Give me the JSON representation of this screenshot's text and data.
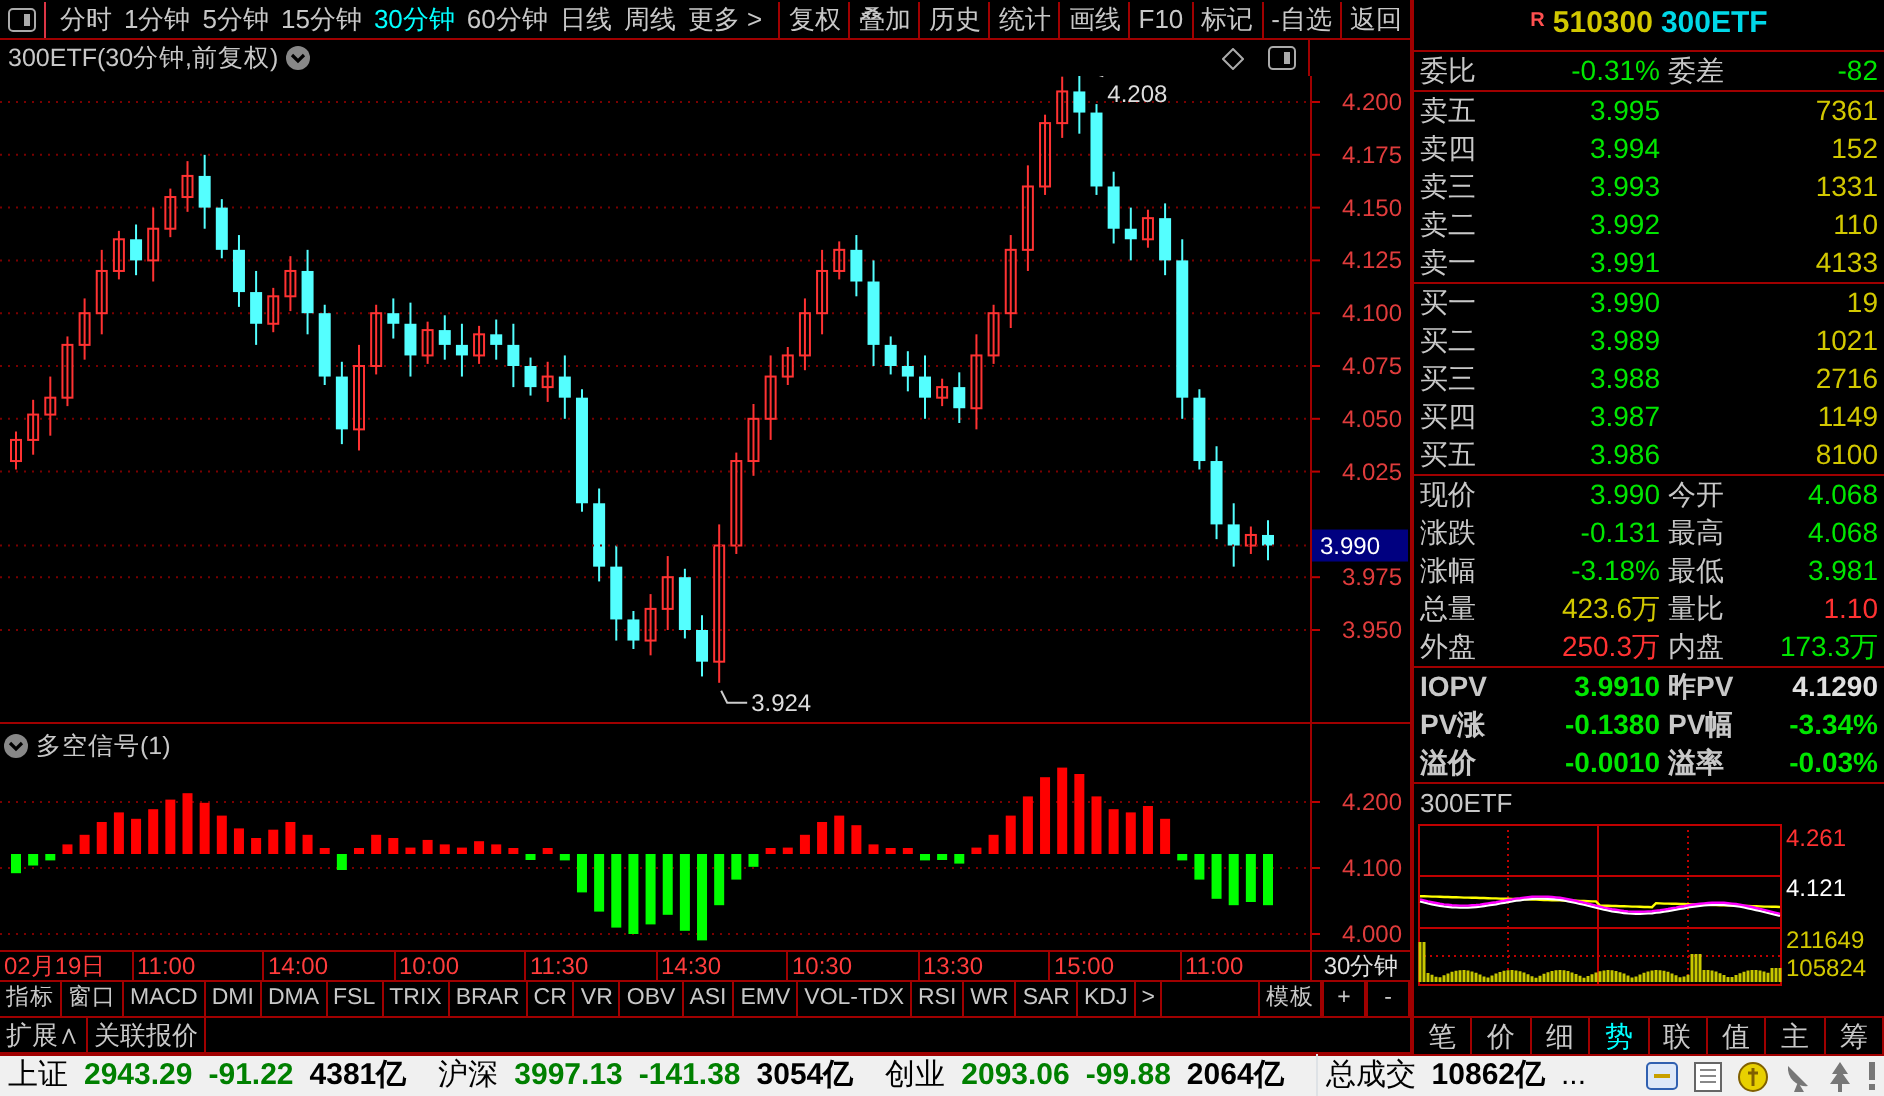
{
  "toolbar": {
    "periods": [
      {
        "label": "分时",
        "selected": false
      },
      {
        "label": "1分钟",
        "selected": false
      },
      {
        "label": "5分钟",
        "selected": false
      },
      {
        "label": "15分钟",
        "selected": false
      },
      {
        "label": "30分钟",
        "selected": true
      },
      {
        "label": "60分钟",
        "selected": false
      },
      {
        "label": "日线",
        "selected": false
      },
      {
        "label": "周线",
        "selected": false
      },
      {
        "label": "更多 >",
        "selected": false
      }
    ],
    "buttons": [
      "复权",
      "叠加",
      "历史",
      "统计",
      "画线",
      "F10",
      "标记",
      "-自选",
      "返回"
    ]
  },
  "chart": {
    "title": "300ETF(30分钟,前复权)",
    "high_label": "4.208",
    "low_label": "3.924",
    "price_ticks": [
      "4.200",
      "4.175",
      "4.150",
      "4.125",
      "4.100",
      "4.075",
      "4.050",
      "4.025",
      "3.975",
      "3.950"
    ],
    "current_price": "3.990"
  },
  "indicator": {
    "title": "多空信号(1)",
    "ticks": [
      "4.200",
      "4.100",
      "4.000"
    ]
  },
  "time_axis": {
    "date": "02月19日",
    "times": [
      "11:00",
      "14:00",
      "10:00",
      "11:30",
      "14:30",
      "10:30",
      "13:30",
      "15:00",
      "11:00"
    ],
    "period": "30分钟"
  },
  "indicator_tabs": {
    "items": [
      "指标",
      "窗口",
      "MACD",
      "DMI",
      "DMA",
      "FSL",
      "TRIX",
      "BRAR",
      "CR",
      "VR",
      "OBV",
      "ASI",
      "EMV",
      "VOL-TDX",
      "RSI",
      "WR",
      "SAR",
      "KDJ",
      ">"
    ],
    "right": [
      "模板",
      "+",
      "-"
    ]
  },
  "extra_tabs": [
    "扩展∧",
    "关联报价"
  ],
  "quote": {
    "flag": "R",
    "code": "510300",
    "name": "300ETF",
    "summary": [
      {
        "label": "委比",
        "value": "-0.31%"
      },
      {
        "label": "委差",
        "value": "-82"
      }
    ],
    "asks": [
      {
        "label": "卖五",
        "price": "3.995",
        "volume": "7361"
      },
      {
        "label": "卖四",
        "price": "3.994",
        "volume": "152"
      },
      {
        "label": "卖三",
        "price": "3.993",
        "volume": "1331"
      },
      {
        "label": "卖二",
        "price": "3.992",
        "volume": "110"
      },
      {
        "label": "卖一",
        "price": "3.991",
        "volume": "4133"
      }
    ],
    "bids": [
      {
        "label": "买一",
        "price": "3.990",
        "volume": "19"
      },
      {
        "label": "买二",
        "price": "3.989",
        "volume": "1021"
      },
      {
        "label": "买三",
        "price": "3.988",
        "volume": "2716"
      },
      {
        "label": "买四",
        "price": "3.987",
        "volume": "1149"
      },
      {
        "label": "买五",
        "price": "3.986",
        "volume": "8100"
      }
    ],
    "stats": [
      {
        "label": "现价",
        "value": "3.990",
        "color": "#00e600"
      },
      {
        "label": "今开",
        "value": "4.068",
        "color": "#00e600"
      },
      {
        "label": "涨跌",
        "value": "-0.131",
        "color": "#00e600"
      },
      {
        "label": "最高",
        "value": "4.068",
        "color": "#00e600"
      },
      {
        "label": "涨幅",
        "value": "-3.18%",
        "color": "#00e600"
      },
      {
        "label": "最低",
        "value": "3.981",
        "color": "#00e600"
      },
      {
        "label": "总量",
        "value": "423.6万",
        "color": "#d2c800"
      },
      {
        "label": "量比",
        "value": "1.10",
        "color": "#ff3232"
      },
      {
        "label": "外盘",
        "value": "250.3万",
        "color": "#ff3232"
      },
      {
        "label": "内盘",
        "value": "173.3万",
        "color": "#00e600"
      }
    ],
    "iopv": [
      {
        "label": "IOPV",
        "value": "3.9910",
        "color": "#00e600"
      },
      {
        "label": "昨PV",
        "value": "4.1290",
        "color": "#e0e0e0"
      },
      {
        "label": "PV涨",
        "value": "-0.1380",
        "color": "#00e600"
      },
      {
        "label": "PV幅",
        "value": "-3.34%",
        "color": "#00e600"
      },
      {
        "label": "溢价",
        "value": "-0.0010",
        "color": "#00e600"
      },
      {
        "label": "溢率",
        "value": "-0.03%",
        "color": "#00e600"
      }
    ]
  },
  "mini_chart": {
    "title": "300ETF",
    "labels": [
      {
        "text": "4.261",
        "color": "#ff3232"
      },
      {
        "text": "4.121",
        "color": "#ffffff"
      },
      {
        "text": "211649",
        "color": "#d2c800"
      },
      {
        "text": "105824",
        "color": "#d2c800"
      }
    ],
    "tabs": [
      {
        "label": "笔",
        "selected": false
      },
      {
        "label": "价",
        "selected": false
      },
      {
        "label": "细",
        "selected": false
      },
      {
        "label": "势",
        "selected": true
      },
      {
        "label": "联",
        "selected": false
      },
      {
        "label": "值",
        "selected": false
      },
      {
        "label": "主",
        "selected": false
      },
      {
        "label": "筹",
        "selected": false
      }
    ]
  },
  "status_bar": {
    "indices": [
      {
        "name": "上证",
        "value": "2943.29",
        "change": "-91.22",
        "amount": "4381亿"
      },
      {
        "name": "沪深",
        "value": "3997.13",
        "change": "-141.38",
        "amount": "3054亿"
      },
      {
        "name": "创业",
        "value": "2093.06",
        "change": "-99.88",
        "amount": "2064亿"
      }
    ],
    "total": {
      "label": "总成交",
      "value": "10862亿",
      "more": "..."
    }
  }
}
